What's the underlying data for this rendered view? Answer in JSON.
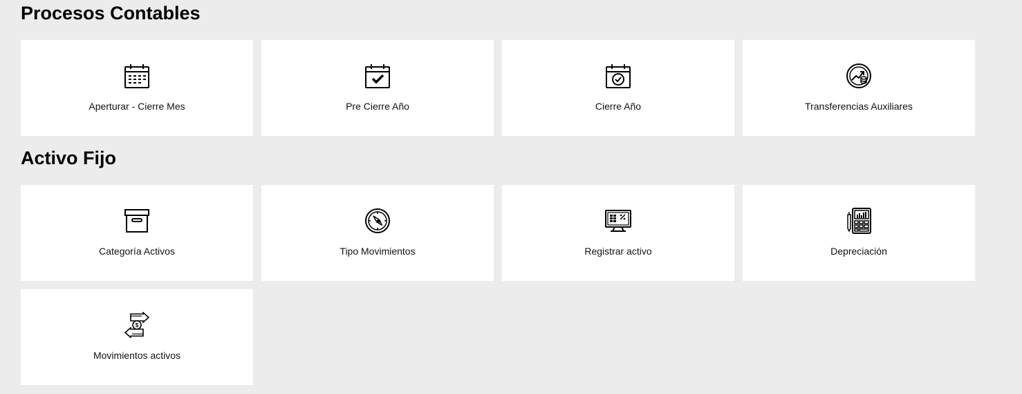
{
  "sections": [
    {
      "title": "Procesos Contables",
      "cards": [
        {
          "label": "Aperturar - Cierre Mes",
          "icon": "calendar-grid-icon"
        },
        {
          "label": "Pre Cierre Año",
          "icon": "calendar-check-icon"
        },
        {
          "label": "Cierre Año",
          "icon": "calendar-check-circle-icon"
        },
        {
          "label": "Transferencias Auxiliares",
          "icon": "transfer-coins-icon"
        }
      ]
    },
    {
      "title": "Activo Fijo",
      "cards": [
        {
          "label": "Categoría Activos",
          "icon": "archive-box-icon"
        },
        {
          "label": "Tipo Movimientos",
          "icon": "compass-icon"
        },
        {
          "label": "Registrar activo",
          "icon": "computer-calculator-icon"
        },
        {
          "label": "Depreciación",
          "icon": "calculator-chart-icon"
        },
        {
          "label": "Movimientos activos",
          "icon": "money-exchange-icon"
        }
      ]
    }
  ]
}
